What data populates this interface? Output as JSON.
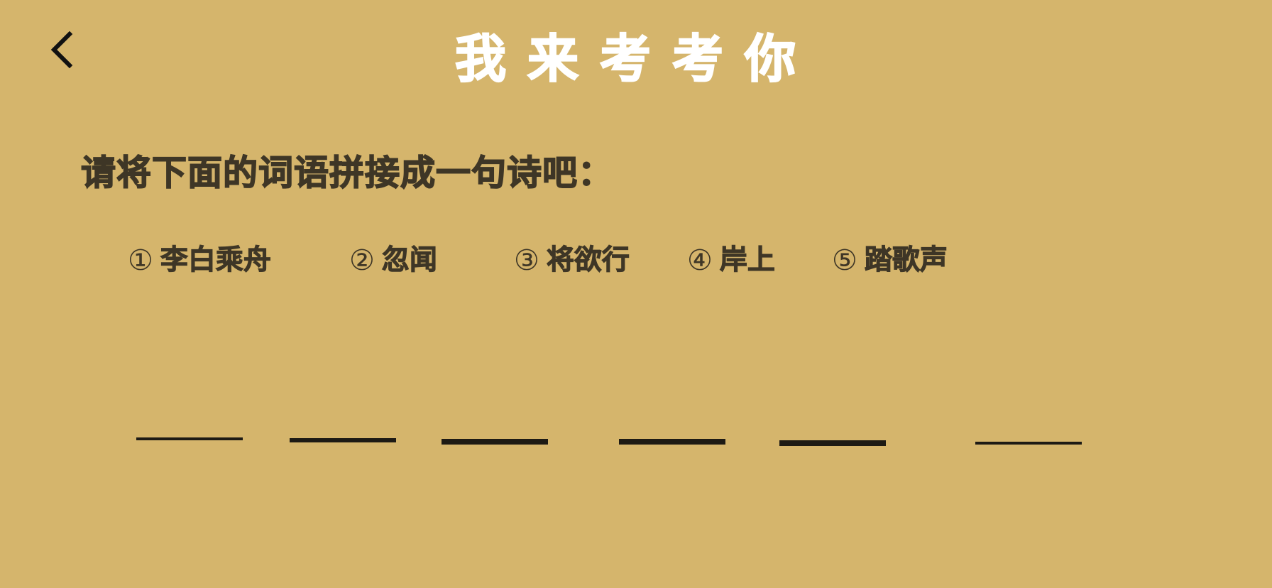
{
  "header": {
    "back_icon": "chevron-left-icon",
    "title": "我来考考你"
  },
  "instruction": "请将下面的词语拼接成一句诗吧：",
  "options": [
    {
      "num": "①",
      "text": "李白乘舟"
    },
    {
      "num": "②",
      "text": "忽闻"
    },
    {
      "num": "③",
      "text": "将欲行"
    },
    {
      "num": "④",
      "text": "岸上"
    },
    {
      "num": "⑤",
      "text": "踏歌声"
    }
  ],
  "answer_blanks_count": 6,
  "colors": {
    "background": "#d5b56c",
    "title": "#ffffff",
    "text": "#3e3626",
    "blank_line": "#1d1a14"
  }
}
